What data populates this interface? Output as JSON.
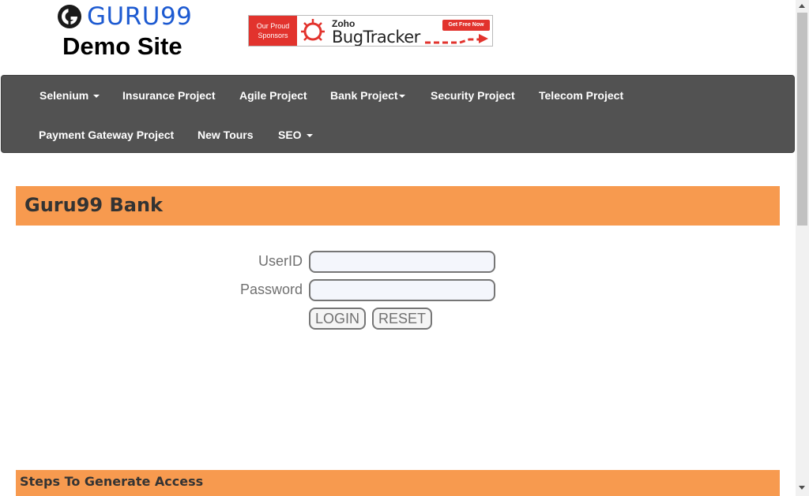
{
  "header": {
    "logo_text": "GURU99",
    "subtitle": "Demo Site"
  },
  "sponsor": {
    "left_line1": "Our Proud",
    "left_line2": "Sponsors",
    "brand": "Zoho",
    "product": "BugTracker",
    "cta": "Get Free Now",
    "accent_color": "#e2332d"
  },
  "nav": {
    "selenium": "Selenium",
    "insurance": "Insurance Project",
    "agile": "Agile Project",
    "bank": "Bank Project",
    "security": "Security Project",
    "telecom": "Telecom Project",
    "payment": "Payment Gateway Project",
    "new_tours": "New Tours",
    "seo": "SEO",
    "background_color": "#525252"
  },
  "bank": {
    "title": "Guru99 Bank",
    "bar_color": "#f79a4f"
  },
  "login": {
    "userid_label": "UserID",
    "userid_value": "",
    "password_label": "Password",
    "password_value": "",
    "login_button": "LOGIN",
    "reset_button": "RESET"
  },
  "steps": {
    "title": "Steps To Generate Access"
  }
}
